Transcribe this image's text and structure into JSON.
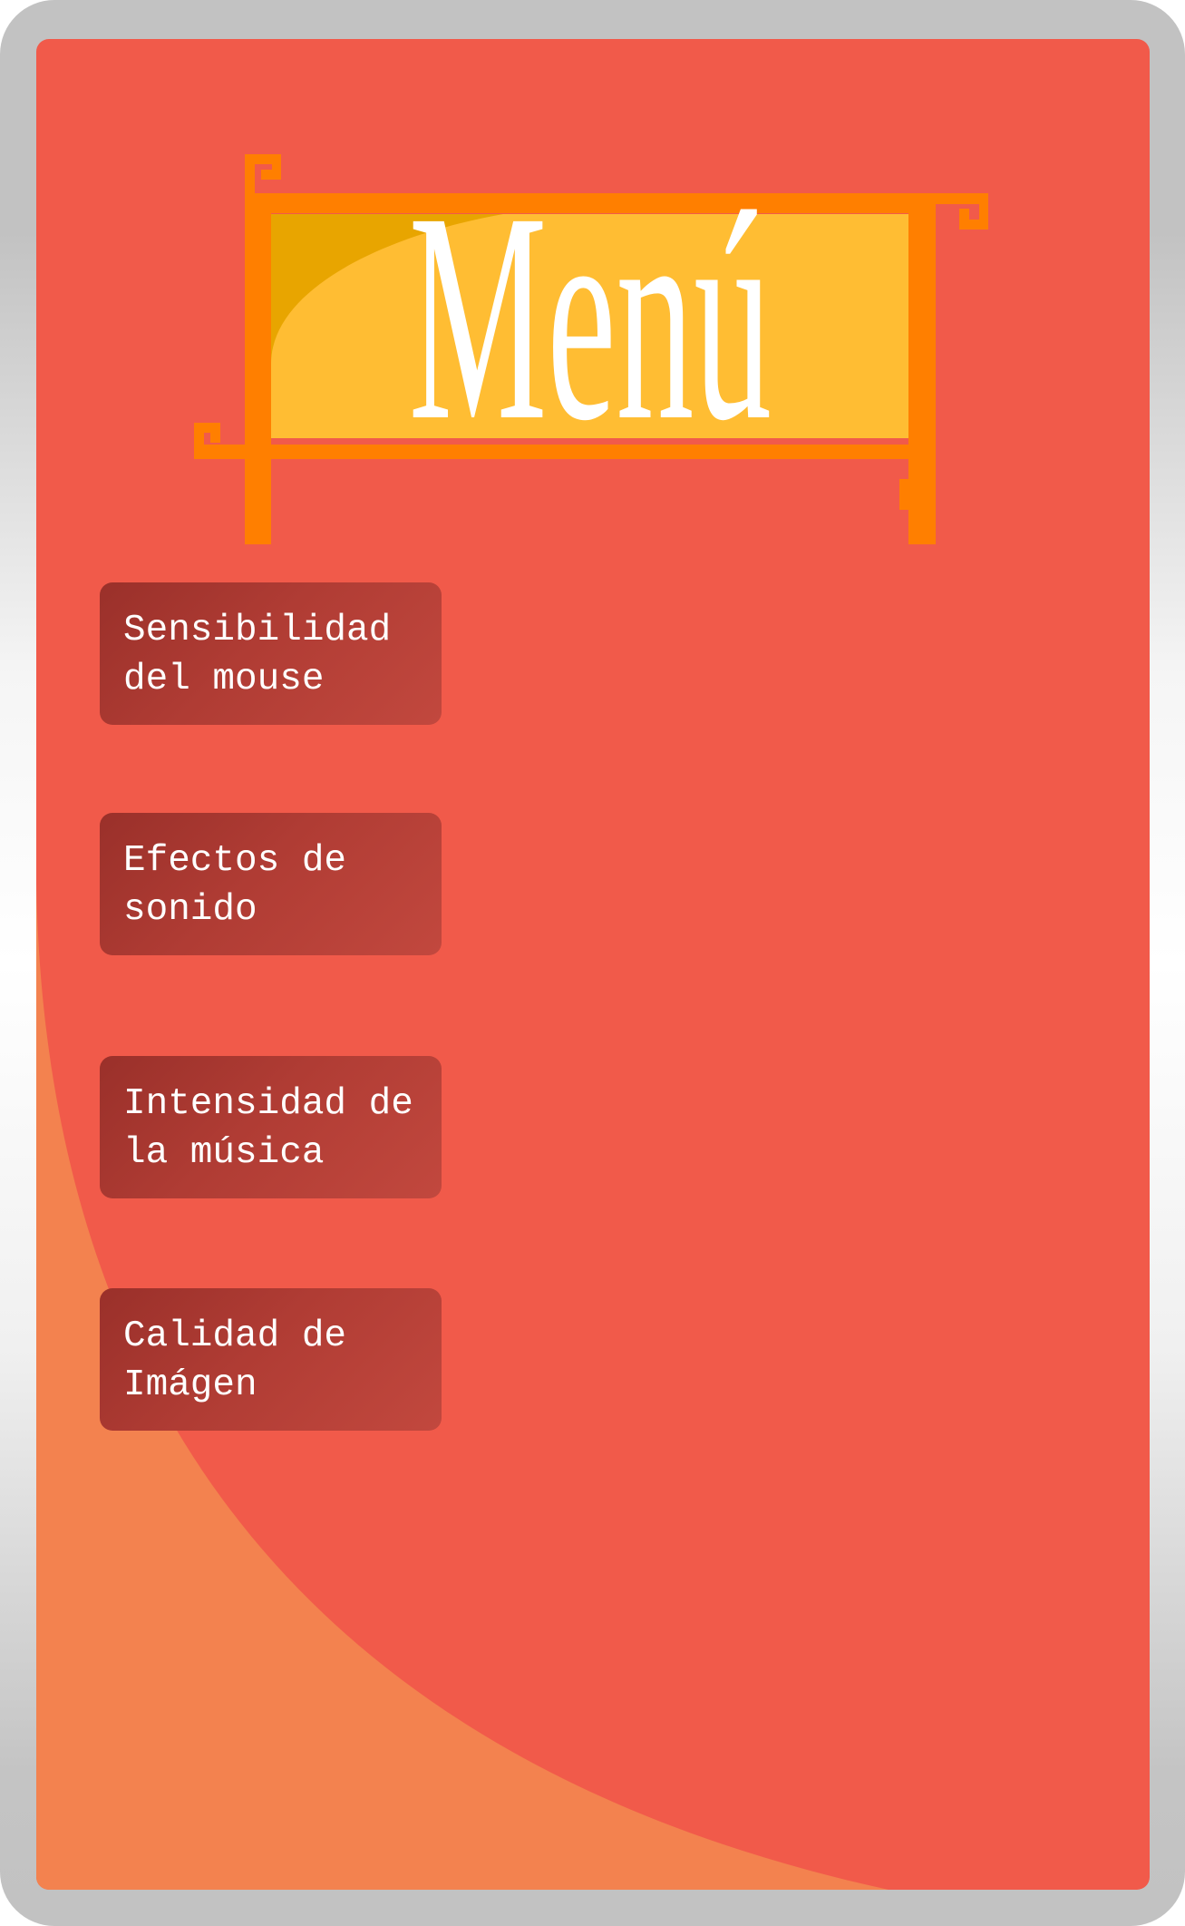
{
  "title": "Menú",
  "buttons": [
    {
      "label": "Sensibilidad del mouse"
    },
    {
      "label": "Efectos de sonido"
    },
    {
      "label": "Intensidad de la música"
    },
    {
      "label": "Calidad de Imágen"
    }
  ],
  "colors": {
    "background": "#F15A4A",
    "accent_curve": "#F3824F",
    "frame_orange": "#FF7F00",
    "title_fill": "#FFBD33",
    "button": "#A8362F"
  }
}
